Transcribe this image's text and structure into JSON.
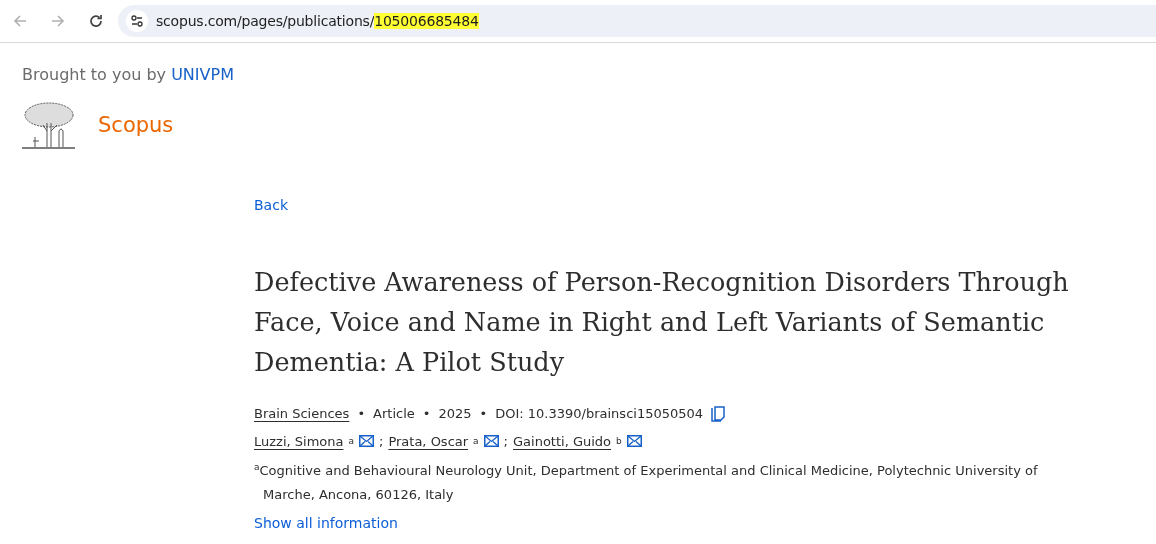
{
  "browser": {
    "url_parts": [
      {
        "text": "scopus.com/pages/publications/",
        "highlighted": false
      },
      {
        "text": "105006685484",
        "highlighted": true
      }
    ]
  },
  "header": {
    "brought_by": "Brought to you by",
    "institution": "UNIVPM",
    "brand": "Scopus"
  },
  "back": "Back",
  "title": "Defective Awareness of Person-Recognition Disorders Through Face, Voice and Name in Right and Left Variants of Semantic Dementia: A Pilot Study",
  "meta": [
    {
      "text": "Brain Sciences",
      "link": true
    },
    {
      "separator": "•",
      "text": "Article",
      "link": false
    },
    {
      "separator": "•",
      "text": "2025",
      "link": false
    },
    {
      "separator": "•",
      "text": "DOI: 10.3390/brainsci15050504",
      "link": false
    }
  ],
  "authors": [
    {
      "name": "Luzzi, Simona",
      "mark": "a"
    },
    {
      "separator": ";",
      "name": "Prata, Oscar",
      "mark": "a"
    },
    {
      "separator": ";",
      "name": "Gainotti, Guido",
      "mark": "b"
    }
  ],
  "affiliations": [
    {
      "mark": "a",
      "text": "Cognitive and Behavioural Neurology Unit, Department of Experimental and Clinical Medicine, Polytechnic University of Marche, Ancona, 60126, Italy"
    }
  ],
  "show_all": "Show all information"
}
